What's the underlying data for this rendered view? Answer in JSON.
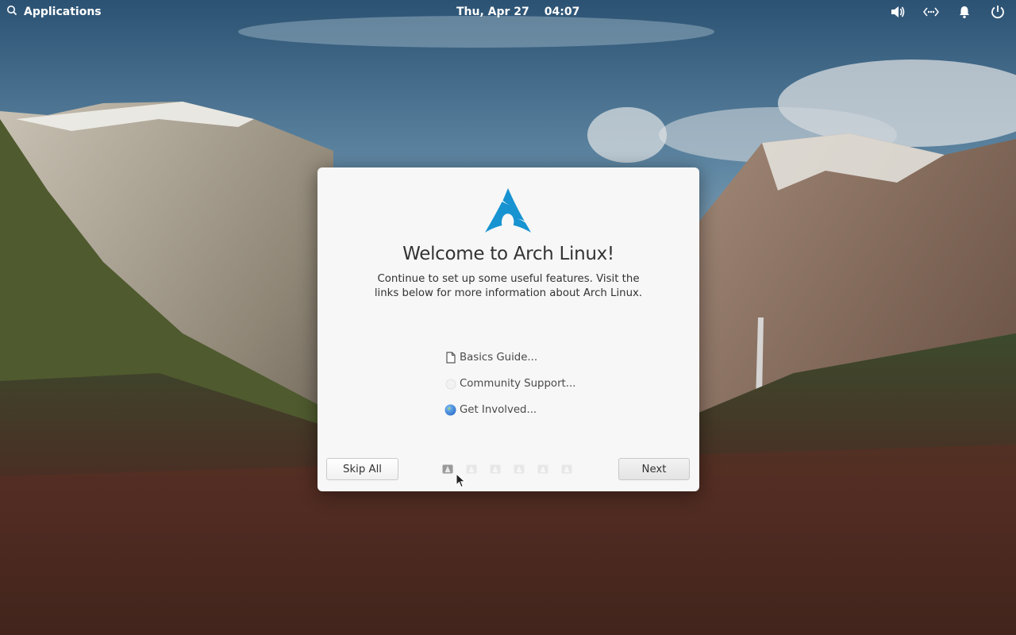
{
  "top_panel": {
    "applications_label": "Applications",
    "date": "Thu, Apr 27",
    "time": "04:07",
    "tray_icons": [
      "volume-icon",
      "network-icon",
      "notification-bell-icon",
      "power-icon"
    ]
  },
  "dialog": {
    "title": "Welcome to Arch Linux!",
    "description": "Continue to set up some useful features. Visit the links below for more information about Arch Linux.",
    "links": [
      {
        "label": "Basics Guide...",
        "icon": "document-icon"
      },
      {
        "label": "Community Support...",
        "icon": "community-icon"
      },
      {
        "label": "Get Involved...",
        "icon": "globe-icon"
      }
    ],
    "skip_label": "Skip All",
    "next_label": "Next",
    "pages_total": 6,
    "current_page": 1
  },
  "colors": {
    "arch_blue": "#1793d1",
    "dialog_bg": "#f7f7f7"
  }
}
